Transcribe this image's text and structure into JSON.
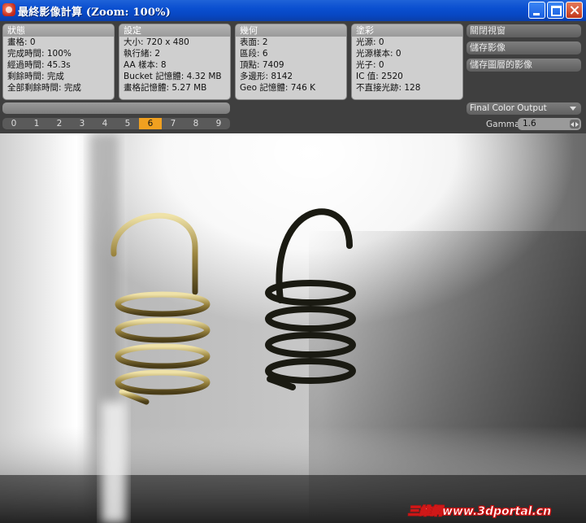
{
  "window": {
    "title": "最終影像計算 (Zoom: 100%)"
  },
  "panels": {
    "status": {
      "header": "狀態",
      "rows": [
        "畫格: 0",
        "完成時間: 100%",
        "經過時間: 45.3s",
        "剩餘時間: 完成",
        "全部剩餘時間: 完成"
      ]
    },
    "settings": {
      "header": "設定",
      "rows": [
        "大小: 720 x 480",
        "執行緒: 2",
        "AA 樣本: 8",
        "Bucket 記憶體: 4.32 MB",
        "畫格記憶體: 5.27 MB"
      ]
    },
    "geometry": {
      "header": "幾何",
      "rows": [
        "表面: 2",
        "區段: 6",
        "頂點: 7409",
        "多邊形: 8142",
        "Geo 記憶體: 746 K"
      ]
    },
    "shading": {
      "header": "塗彩",
      "rows": [
        "光源: 0",
        "光源樣本: 0",
        "光子: 0",
        "IC 值: 2520",
        "不直接光跡: 128"
      ]
    }
  },
  "actions": {
    "close_window": "關閉視窗",
    "save_image": "儲存影像",
    "save_layered_image": "儲存圖層的影像"
  },
  "buffers": {
    "items": [
      "0",
      "1",
      "2",
      "3",
      "4",
      "5",
      "6",
      "7",
      "8",
      "9"
    ],
    "active_index": 6
  },
  "output": {
    "selected": "Final Color Output",
    "gamma_label": "Gamma",
    "gamma_value": "1.6"
  },
  "watermark": "三維網www.3dportal.cn",
  "colors": {
    "active_buffer": "#f0a020",
    "titlebar": "#0a4fd0",
    "spring_gold": "#c9b46a",
    "spring_dark": "#1a1a12"
  },
  "icons": {
    "app": "app-icon",
    "minimize": "minimize-icon",
    "maximize": "maximize-icon",
    "close": "close-icon",
    "dropdown": "chevron-down-icon",
    "stepper": "stepper-icon"
  }
}
